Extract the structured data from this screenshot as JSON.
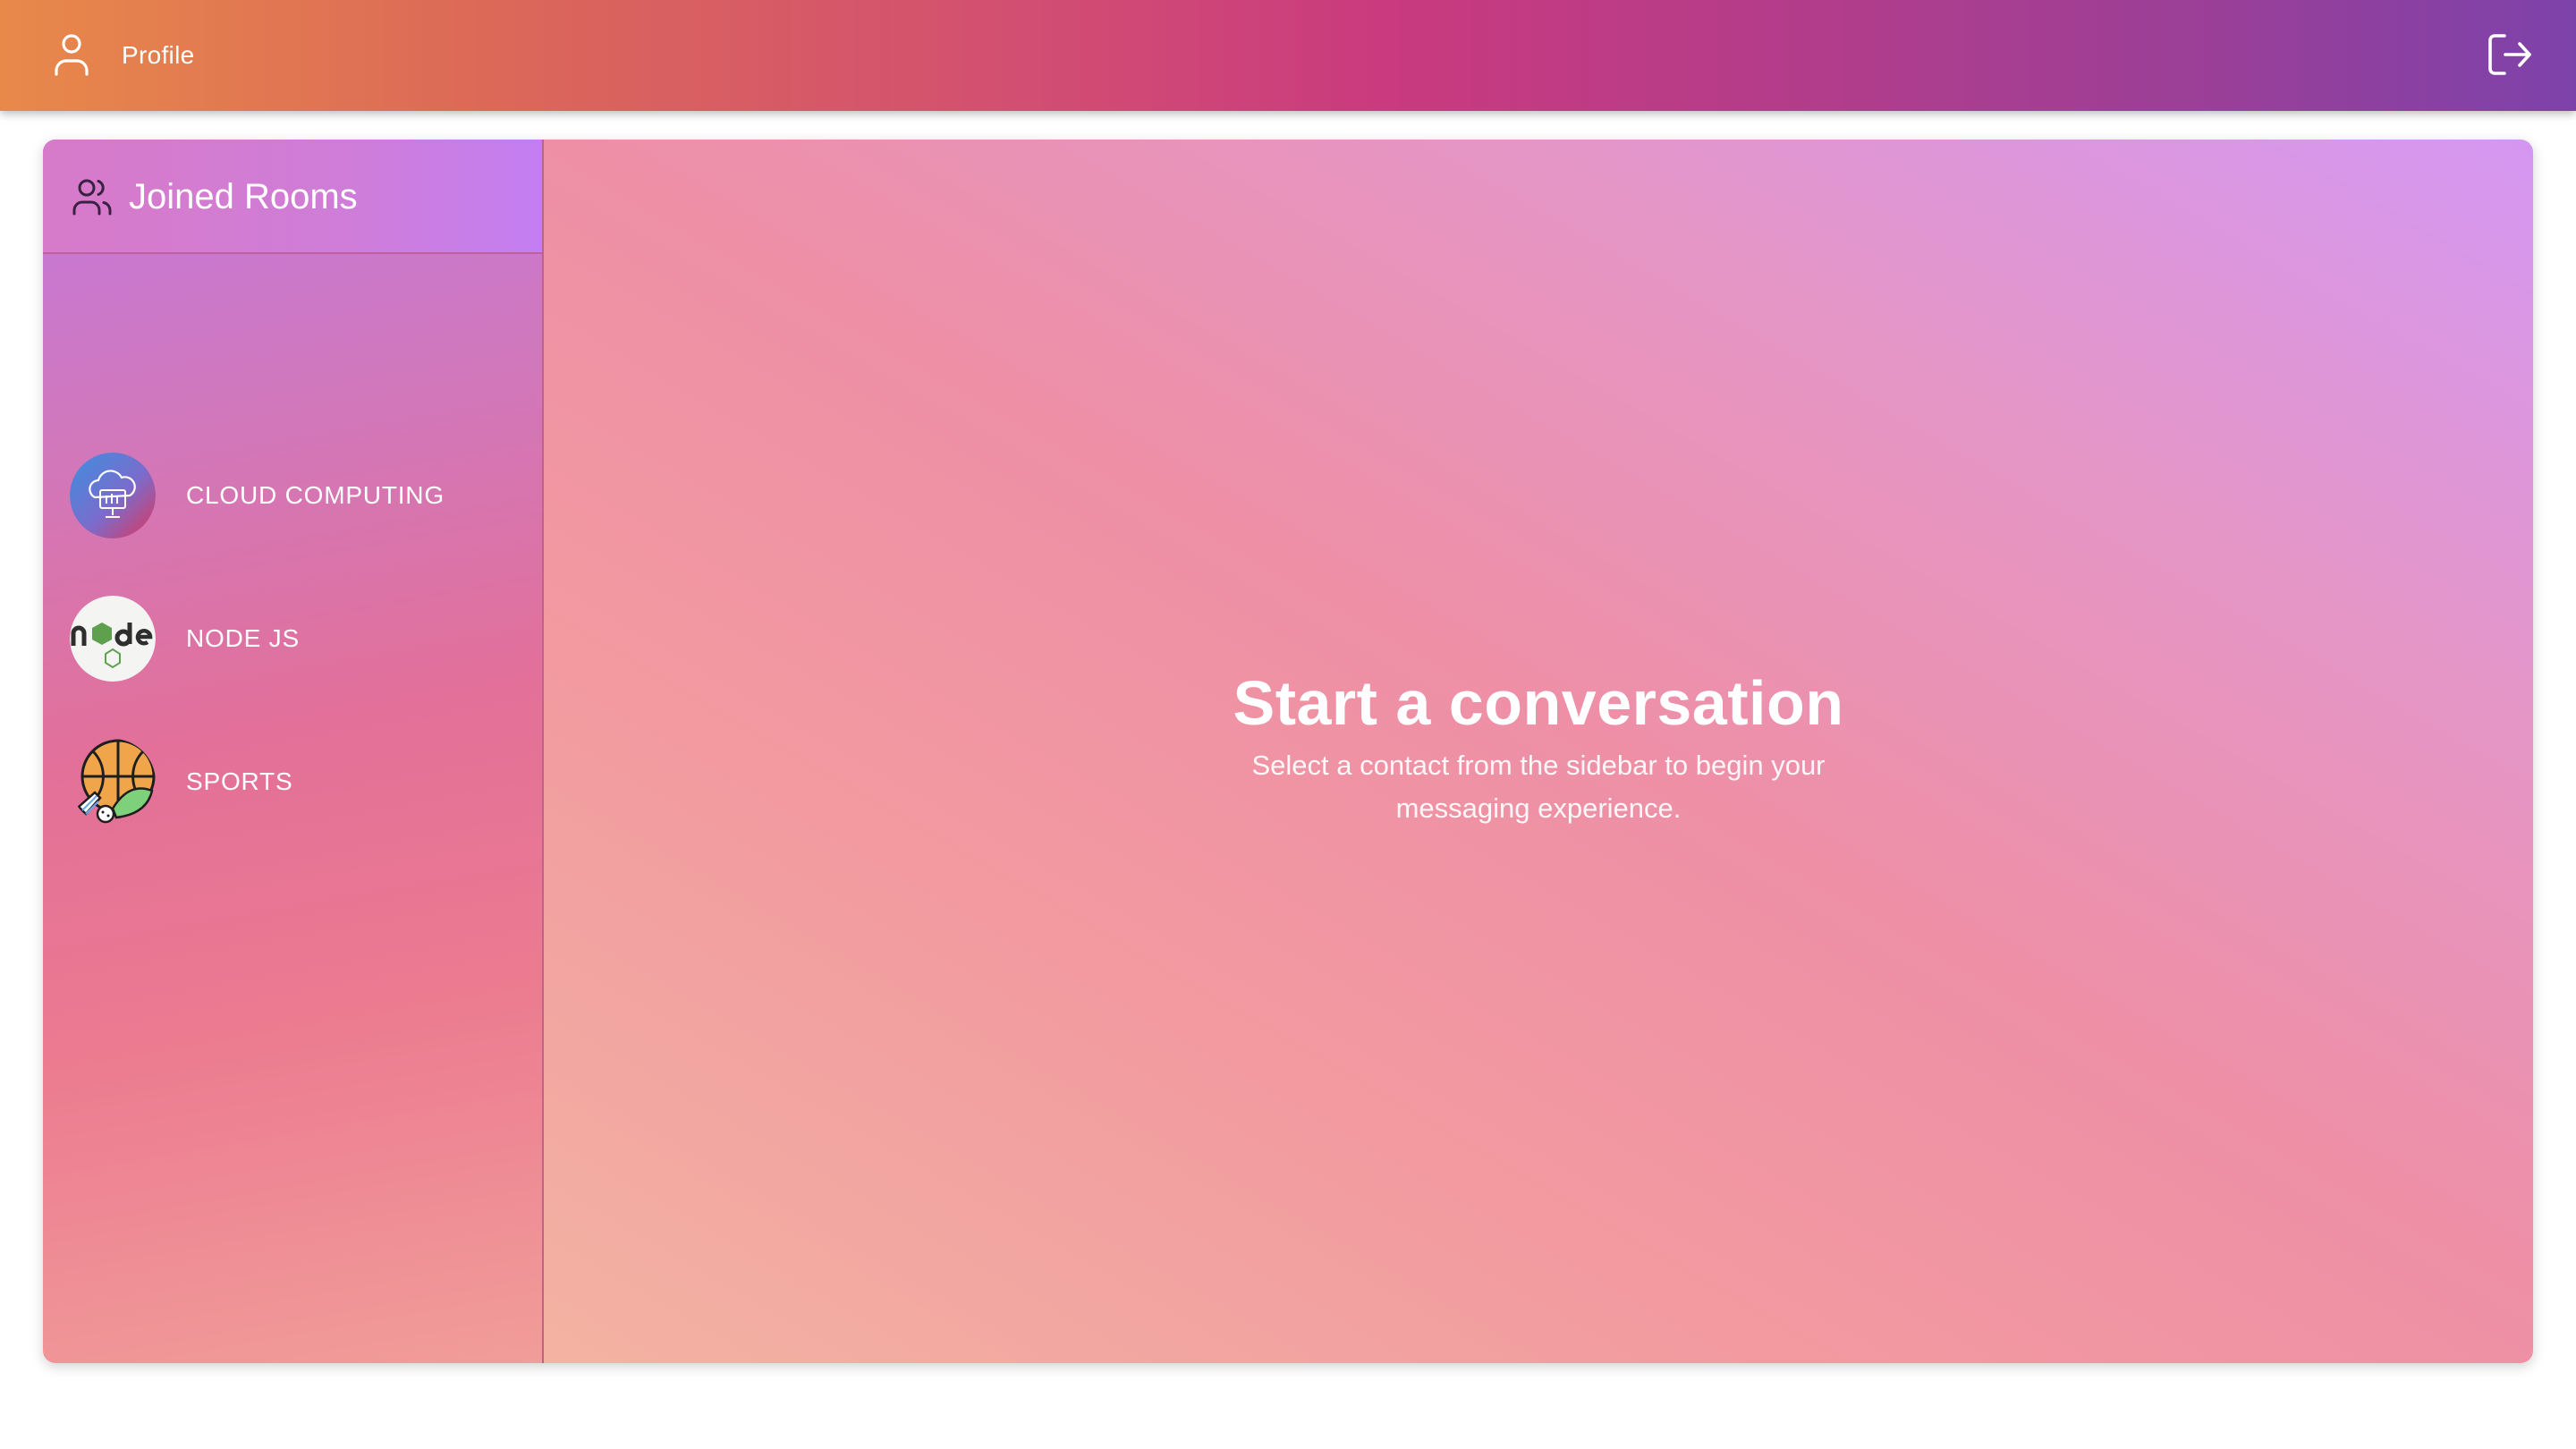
{
  "header": {
    "profile_label": "Profile",
    "profile_icon": "user-icon",
    "logout_icon": "logout-icon"
  },
  "sidebar": {
    "title": "Joined Rooms",
    "title_icon": "users-icon",
    "rooms": [
      {
        "name": "CLOUD COMPUTING",
        "avatar": "cloud-computing-avatar"
      },
      {
        "name": "NODE JS",
        "avatar": "nodejs-logo-avatar"
      },
      {
        "name": "SPORTS",
        "avatar": "sports-avatar"
      }
    ]
  },
  "main": {
    "empty_title": "Start a conversation",
    "empty_subtitle": "Select a contact from the sidebar to begin your messaging experience."
  },
  "colors": {
    "topbar_start": "#e8894a",
    "topbar_mid": "#c93a7f",
    "topbar_end": "#7d42aa",
    "sidebar_header": "#cf7dd8",
    "chat_accent": "#ee8fa6"
  }
}
